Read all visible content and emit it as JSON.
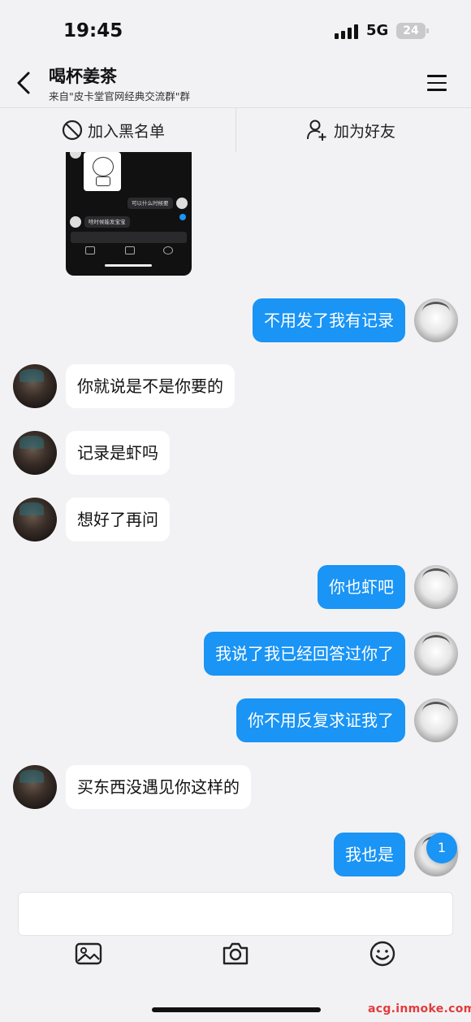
{
  "status_bar": {
    "time": "19:45",
    "network": "5G",
    "battery": "24"
  },
  "header": {
    "title": "喝杯姜茶",
    "subtitle": "来自\"皮卡堂官网经典交流群\"群"
  },
  "actions": {
    "blacklist": "加入黑名单",
    "add_friend": "加为好友"
  },
  "screenshot_message": {
    "bubble_1": "可以什么时候要",
    "bubble_2": "啥时候能发宝宝"
  },
  "messages": [
    {
      "side": "right",
      "text": "不用发了我有记录"
    },
    {
      "side": "left",
      "text": "你就说是不是你要的"
    },
    {
      "side": "left",
      "text": "记录是虾吗"
    },
    {
      "side": "left",
      "text": "想好了再问"
    },
    {
      "side": "right",
      "text": "你也虾吧"
    },
    {
      "side": "right",
      "text": "我说了我已经回答过你了"
    },
    {
      "side": "right",
      "text": "你不用反复求证我了"
    },
    {
      "side": "left",
      "text": "买东西没遇见你这样的"
    },
    {
      "side": "right",
      "text": "我也是"
    }
  ],
  "unread_badge": "1",
  "input": {
    "placeholder": ""
  },
  "toolbar": {
    "icons": [
      "image-icon",
      "camera-icon",
      "emoji-icon"
    ]
  },
  "watermark": "acg.inmoke.com",
  "colors": {
    "accent": "#1a94f5",
    "background": "#f2f2f4",
    "bubble_left": "#ffffff"
  }
}
